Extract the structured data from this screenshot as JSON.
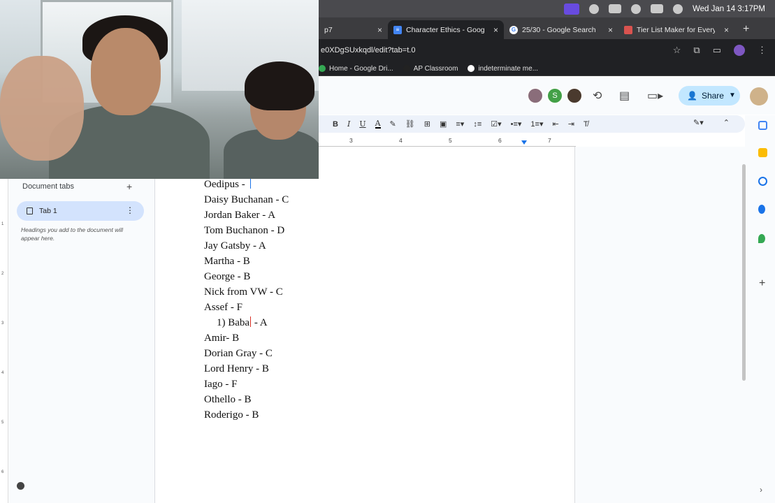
{
  "menubar": {
    "clock": "Wed Jan 14  3:17PM"
  },
  "browser": {
    "tabs": [
      {
        "title": "p7",
        "close": "×",
        "favicon_color": "#8a8a8a",
        "active": false
      },
      {
        "title": "Character Ethics - Google",
        "close": "×",
        "favicon_color": "#4285f4",
        "active": true
      },
      {
        "title": "25/30 - Google Search",
        "close": "×",
        "favicon_color": "#ffffff",
        "active": false
      },
      {
        "title": "Tier List Maker for Everyth",
        "close": "×",
        "favicon_color": "#d9534f",
        "active": false
      }
    ],
    "new_tab": "+",
    "address": "e0XDgSUxkqdl/edit?tab=t.0",
    "bookmarks": [
      {
        "label": "Home - Google Dri..."
      },
      {
        "label": "AP Classroom"
      },
      {
        "label": "indeterminate me..."
      }
    ]
  },
  "docs_header": {
    "share_label": "Share",
    "avatar_letter": "S"
  },
  "toolbar": {
    "bold": "B",
    "italic": "I",
    "underline": "U",
    "text_color": "A"
  },
  "ruler": {
    "numbers": [
      "3",
      "4",
      "5",
      "6",
      "7"
    ]
  },
  "vertical_ruler": [
    "1",
    "2",
    "3",
    "4",
    "5",
    "6"
  ],
  "outline": {
    "title": "Document tabs",
    "add": "+",
    "tab_label": "Tab 1",
    "tab_menu": "⋮",
    "helper": "Headings you add to the document will appear here."
  },
  "document": {
    "first_line": "Oedipus - ",
    "lines": [
      "Daisy Buchanan - C",
      "Jordan Baker - A",
      "Tom Buchanon - D",
      "Jay Gatsby - A",
      "Martha - B",
      "George - B",
      "Nick from VW - C",
      "Assef  - F"
    ],
    "sub_item_prefix": "1) Baba",
    "sub_item_suffix": " - A",
    "lines_after": [
      "Amir- B",
      "Dorian Gray - C",
      "Lord Henry - B",
      "Iago - F",
      "Othello - B",
      "Roderigo - B"
    ]
  }
}
